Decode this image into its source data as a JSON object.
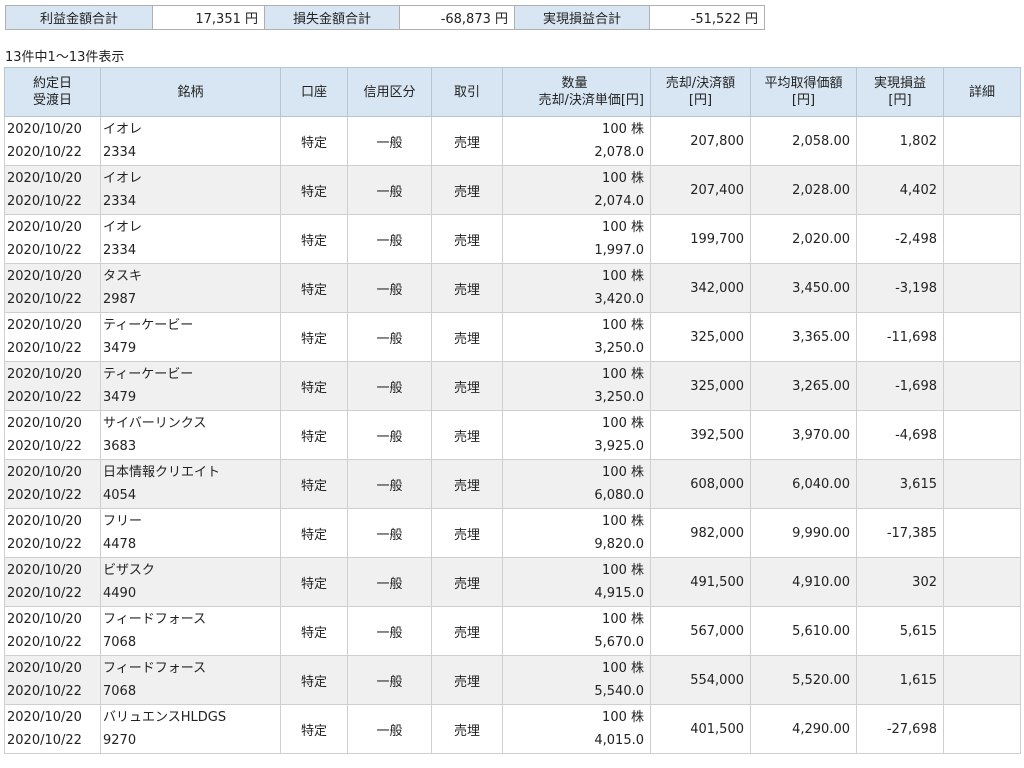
{
  "summary": {
    "profit_label": "利益金額合計",
    "profit_value": "17,351 円",
    "loss_label": "損失金額合計",
    "loss_value": "-68,873 円",
    "realized_label": "実現損益合計",
    "realized_value": "-51,522 円"
  },
  "count_text": "13件中1〜13件表示",
  "headers": {
    "date1": "約定日",
    "date2": "受渡日",
    "stock": "銘柄",
    "account": "口座",
    "margin": "信用区分",
    "trade": "取引",
    "qty1": "数量",
    "qty2": "売却/決済単価[円]",
    "amount1": "売却/決済額",
    "amount2": "[円]",
    "avg1": "平均取得価額",
    "avg2": "[円]",
    "pl1": "実現損益",
    "pl2": "[円]",
    "detail": "詳細"
  },
  "rows": [
    {
      "trade_date": "2020/10/20",
      "settle_date": "2020/10/22",
      "name": "イオレ",
      "code": "2334",
      "account": "特定",
      "margin": "一般",
      "trade": "売埋",
      "qty": "100 株",
      "unit_price": "2,078.0",
      "amount": "207,800",
      "avg_cost": "2,058.00",
      "pl": "1,802"
    },
    {
      "trade_date": "2020/10/20",
      "settle_date": "2020/10/22",
      "name": "イオレ",
      "code": "2334",
      "account": "特定",
      "margin": "一般",
      "trade": "売埋",
      "qty": "100 株",
      "unit_price": "2,074.0",
      "amount": "207,400",
      "avg_cost": "2,028.00",
      "pl": "4,402"
    },
    {
      "trade_date": "2020/10/20",
      "settle_date": "2020/10/22",
      "name": "イオレ",
      "code": "2334",
      "account": "特定",
      "margin": "一般",
      "trade": "売埋",
      "qty": "100 株",
      "unit_price": "1,997.0",
      "amount": "199,700",
      "avg_cost": "2,020.00",
      "pl": "-2,498"
    },
    {
      "trade_date": "2020/10/20",
      "settle_date": "2020/10/22",
      "name": "タスキ",
      "code": "2987",
      "account": "特定",
      "margin": "一般",
      "trade": "売埋",
      "qty": "100 株",
      "unit_price": "3,420.0",
      "amount": "342,000",
      "avg_cost": "3,450.00",
      "pl": "-3,198"
    },
    {
      "trade_date": "2020/10/20",
      "settle_date": "2020/10/22",
      "name": "ティーケービー",
      "code": "3479",
      "account": "特定",
      "margin": "一般",
      "trade": "売埋",
      "qty": "100 株",
      "unit_price": "3,250.0",
      "amount": "325,000",
      "avg_cost": "3,365.00",
      "pl": "-11,698"
    },
    {
      "trade_date": "2020/10/20",
      "settle_date": "2020/10/22",
      "name": "ティーケービー",
      "code": "3479",
      "account": "特定",
      "margin": "一般",
      "trade": "売埋",
      "qty": "100 株",
      "unit_price": "3,250.0",
      "amount": "325,000",
      "avg_cost": "3,265.00",
      "pl": "-1,698"
    },
    {
      "trade_date": "2020/10/20",
      "settle_date": "2020/10/22",
      "name": "サイバーリンクス",
      "code": "3683",
      "account": "特定",
      "margin": "一般",
      "trade": "売埋",
      "qty": "100 株",
      "unit_price": "3,925.0",
      "amount": "392,500",
      "avg_cost": "3,970.00",
      "pl": "-4,698"
    },
    {
      "trade_date": "2020/10/20",
      "settle_date": "2020/10/22",
      "name": "日本情報クリエイト",
      "code": "4054",
      "account": "特定",
      "margin": "一般",
      "trade": "売埋",
      "qty": "100 株",
      "unit_price": "6,080.0",
      "amount": "608,000",
      "avg_cost": "6,040.00",
      "pl": "3,615"
    },
    {
      "trade_date": "2020/10/20",
      "settle_date": "2020/10/22",
      "name": "フリー",
      "code": "4478",
      "account": "特定",
      "margin": "一般",
      "trade": "売埋",
      "qty": "100 株",
      "unit_price": "9,820.0",
      "amount": "982,000",
      "avg_cost": "9,990.00",
      "pl": "-17,385"
    },
    {
      "trade_date": "2020/10/20",
      "settle_date": "2020/10/22",
      "name": "ビザスク",
      "code": "4490",
      "account": "特定",
      "margin": "一般",
      "trade": "売埋",
      "qty": "100 株",
      "unit_price": "4,915.0",
      "amount": "491,500",
      "avg_cost": "4,910.00",
      "pl": "302"
    },
    {
      "trade_date": "2020/10/20",
      "settle_date": "2020/10/22",
      "name": "フィードフォース",
      "code": "7068",
      "account": "特定",
      "margin": "一般",
      "trade": "売埋",
      "qty": "100 株",
      "unit_price": "5,670.0",
      "amount": "567,000",
      "avg_cost": "5,610.00",
      "pl": "5,615"
    },
    {
      "trade_date": "2020/10/20",
      "settle_date": "2020/10/22",
      "name": "フィードフォース",
      "code": "7068",
      "account": "特定",
      "margin": "一般",
      "trade": "売埋",
      "qty": "100 株",
      "unit_price": "5,540.0",
      "amount": "554,000",
      "avg_cost": "5,520.00",
      "pl": "1,615"
    },
    {
      "trade_date": "2020/10/20",
      "settle_date": "2020/10/22",
      "name": "バリュエンスHLDGS",
      "code": "9270",
      "account": "特定",
      "margin": "一般",
      "trade": "売埋",
      "qty": "100 株",
      "unit_price": "4,015.0",
      "amount": "401,500",
      "avg_cost": "4,290.00",
      "pl": "-27,698"
    }
  ],
  "colors": {
    "header_bg": "#d8e6f3",
    "alt_row_bg": "#f0f0f0"
  }
}
